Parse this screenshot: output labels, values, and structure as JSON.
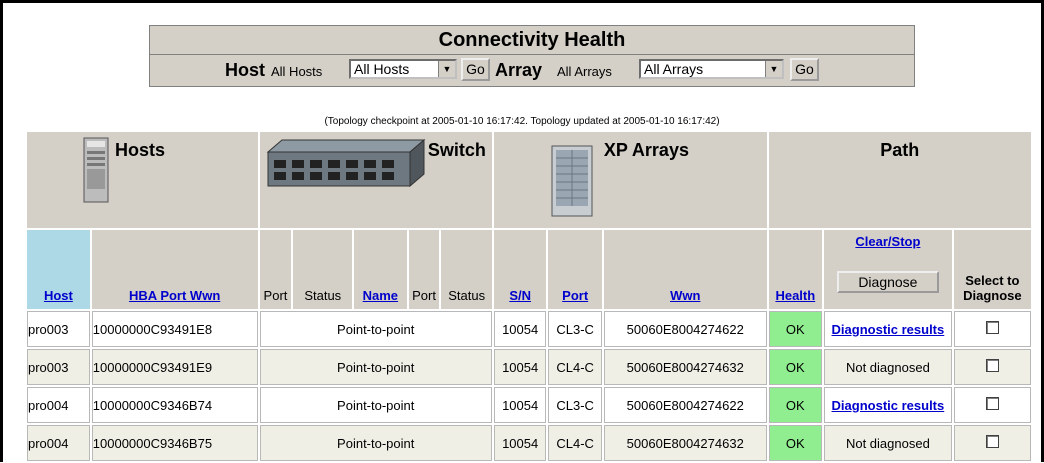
{
  "title": "Connectivity Health",
  "filters": {
    "host_label": "Host",
    "host_small": "All Hosts",
    "host_select": "All Hosts",
    "host_go": "Go",
    "array_label": "Array",
    "array_small": "All Arrays",
    "array_select": "All Arrays",
    "array_go": "Go"
  },
  "caption": "(Topology checkpoint at 2005-01-10 16:17:42. Topology updated at 2005-01-10 16:17:42)",
  "groups": {
    "hosts": "Hosts",
    "switch": "Switch",
    "xp_arrays": "XP Arrays",
    "path": "Path"
  },
  "columns": {
    "host": "Host",
    "hba_port_wwn": "HBA Port Wwn",
    "port1": "Port",
    "status1": "Status",
    "name": "Name",
    "port2": "Port",
    "status2": "Status",
    "sn": "S/N",
    "port": "Port",
    "wwn": "Wwn",
    "health": "Health",
    "clear_stop": "Clear/Stop",
    "diagnose": "Diagnose",
    "select_to_diagnose": "Select to Diagnose"
  },
  "rows": [
    {
      "host": "pro003",
      "hba": "10000000C93491E8",
      "switch": "Point-to-point",
      "sn": "10054",
      "port": "CL3-C",
      "wwn": "50060E8004274622",
      "health": "OK",
      "diag": "Diagnostic results",
      "diag_link": true
    },
    {
      "host": "pro003",
      "hba": "10000000C93491E9",
      "switch": "Point-to-point",
      "sn": "10054",
      "port": "CL4-C",
      "wwn": "50060E8004274632",
      "health": "OK",
      "diag": "Not diagnosed",
      "diag_link": false
    },
    {
      "host": "pro004",
      "hba": "10000000C9346B74",
      "switch": "Point-to-point",
      "sn": "10054",
      "port": "CL3-C",
      "wwn": "50060E8004274622",
      "health": "OK",
      "diag": "Diagnostic results",
      "diag_link": true
    },
    {
      "host": "pro004",
      "hba": "10000000C9346B75",
      "switch": "Point-to-point",
      "sn": "10054",
      "port": "CL4-C",
      "wwn": "50060E8004274632",
      "health": "OK",
      "diag": "Not diagnosed",
      "diag_link": false
    }
  ],
  "colors": {
    "panel": "#d4d0c8",
    "link": "#0000cc",
    "ok": "#90ee90",
    "host_header": "#add8e6"
  },
  "icons": [
    "server-icon",
    "switch-icon",
    "storage-array-icon",
    "checkbox-icon",
    "dropdown-arrow-icon"
  ]
}
